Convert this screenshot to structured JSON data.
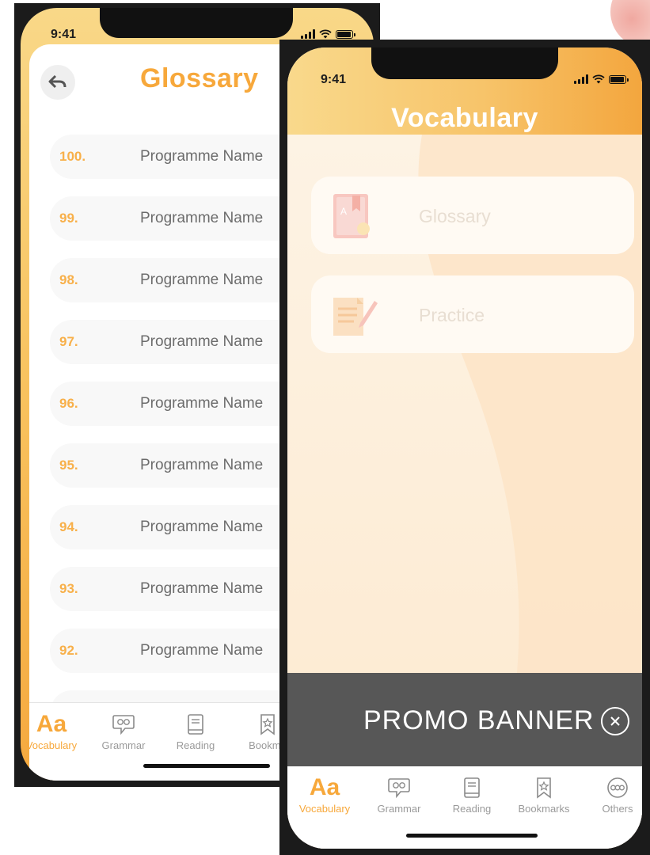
{
  "status_bar": {
    "time": "9:41"
  },
  "glossary_screen": {
    "title": "Glossary",
    "rows": [
      {
        "number": "100.",
        "name": "Programme Name"
      },
      {
        "number": "99.",
        "name": "Programme Name"
      },
      {
        "number": "98.",
        "name": "Programme Name"
      },
      {
        "number": "97.",
        "name": "Programme Name"
      },
      {
        "number": "96.",
        "name": "Programme Name"
      },
      {
        "number": "95.",
        "name": "Programme Name"
      },
      {
        "number": "94.",
        "name": "Programme Name"
      },
      {
        "number": "93.",
        "name": "Programme Name"
      },
      {
        "number": "92.",
        "name": "Programme Name"
      }
    ],
    "tabs": [
      {
        "label": "Vocabulary",
        "icon": "aa-icon",
        "active": true
      },
      {
        "label": "Grammar",
        "icon": "speech-bubble-icon"
      },
      {
        "label": "Reading",
        "icon": "book-icon"
      },
      {
        "label": "Bookma",
        "icon": "bookmark-star-icon"
      }
    ]
  },
  "vocabulary_screen": {
    "title": "Vocabulary",
    "menu": [
      {
        "label": "Glossary",
        "icon": "glossary-book-icon"
      },
      {
        "label": "Practice",
        "icon": "practice-pencil-icon"
      }
    ],
    "promo_banner": "PROMO BANNER",
    "tabs": [
      {
        "label": "Vocabulary",
        "icon": "aa-icon",
        "active": true
      },
      {
        "label": "Grammar",
        "icon": "speech-bubble-icon"
      },
      {
        "label": "Reading",
        "icon": "book-icon"
      },
      {
        "label": "Bookmarks",
        "icon": "bookmark-star-icon"
      },
      {
        "label": "Others",
        "icon": "more-icon"
      }
    ]
  },
  "aa_glyph": "Aa",
  "colors": {
    "accent": "#f7a83b",
    "promo_bg": "#575757",
    "header_start": "#f9d98c",
    "header_end": "#f3a63e"
  }
}
